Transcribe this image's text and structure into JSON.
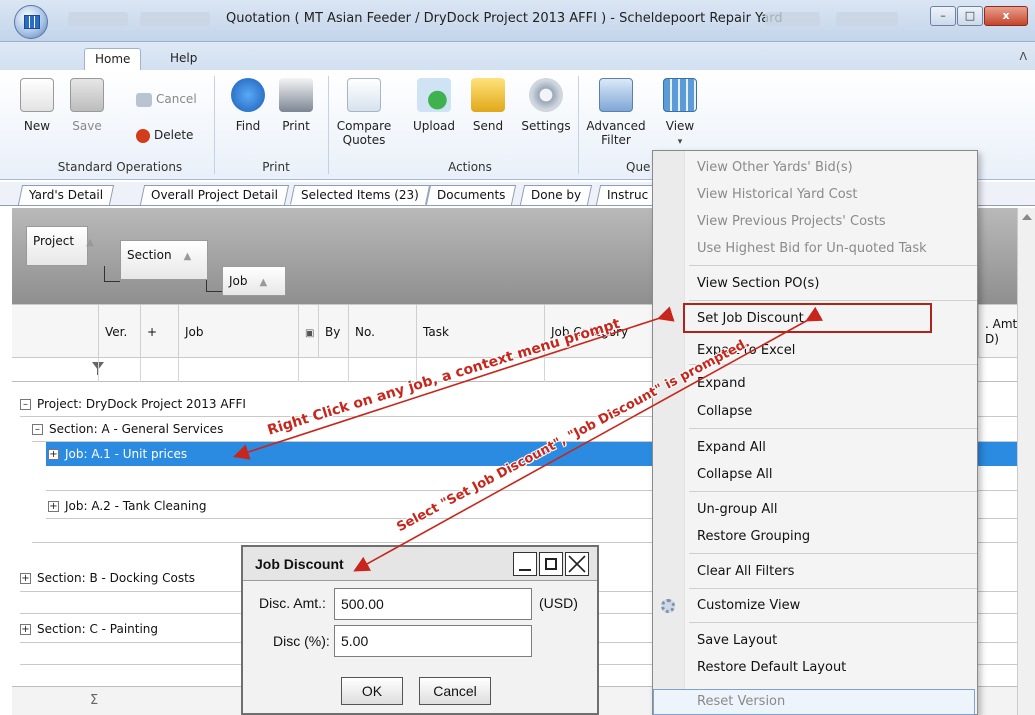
{
  "window": {
    "title": "Quotation ( MT Asian Feeder / DryDock Project 2013 AFFI ) - Scheldepoort Repair Yard",
    "controls": {
      "minimize": "–",
      "maximize": "□",
      "close": "x"
    }
  },
  "ribbon_tabs": [
    "Home",
    "Help"
  ],
  "ribbon": {
    "standard_operations": {
      "label": "Standard Operations",
      "new": "New",
      "save": "Save",
      "cancel": "Cancel",
      "delete": "Delete"
    },
    "print": {
      "label": "Print",
      "find": "Find",
      "print": "Print"
    },
    "actions": {
      "label": "Actions",
      "compare_quotes": "Compare Quotes",
      "upload": "Upload",
      "send": "Send",
      "settings": "Settings"
    },
    "query": {
      "label": "Que",
      "advanced_filter": "Advanced Filter",
      "view": "View"
    }
  },
  "doc_tabs": [
    "Yard's Detail",
    "Overall Project Detail",
    "Selected Items (23)",
    "Documents",
    "Done by",
    "Instruc"
  ],
  "group_by": [
    "Project",
    "Section",
    "Job"
  ],
  "grid": {
    "columns": [
      "Ver.",
      "+",
      "Job",
      "By",
      "No.",
      "Task",
      "Job Category"
    ],
    "right_column": ". Amt D)",
    "rows": [
      {
        "expander": "–",
        "text": "Project:  DryDock Project 2013 AFFI"
      },
      {
        "expander": "–",
        "text": "Section:  A - General Services"
      },
      {
        "expander": "+",
        "text": "Job:  A.1 - Unit prices"
      },
      {
        "expander": "+",
        "text": "Job:  A.2 - Tank Cleaning"
      },
      {
        "expander": "+",
        "text": "Section:  B - Docking Costs"
      },
      {
        "expander": "+",
        "text": "Section:  C - Painting"
      }
    ],
    "summary_symbol": "Σ"
  },
  "context_menu": {
    "items": [
      "View Other Yards' Bid(s)",
      "View Historical Yard Cost",
      "View Previous Projects' Costs",
      "Use Highest Bid for Un-quoted Task",
      "View Section PO(s)",
      "Set Job Discount",
      "Export to Excel",
      "Expand",
      "Collapse",
      "Expand All",
      "Collapse All",
      "Un-group All",
      "Restore Grouping",
      "Clear All Filters",
      "Customize View",
      "Save Layout",
      "Restore Default Layout",
      "Reset Version"
    ]
  },
  "dialog": {
    "title": "Job Discount",
    "disc_amt_label": "Disc. Amt.:",
    "disc_amt_value": "500.00",
    "currency": "(USD)",
    "disc_pct_label": "Disc (%):",
    "disc_pct_value": "5.00",
    "ok": "OK",
    "cancel": "Cancel"
  },
  "annotations": {
    "right_click": "Right Click on any job, a context menu prompt",
    "select": "Select \"Set Job Discount\", \"Job Discount\" is prompted."
  },
  "colors": {
    "selection": "#2a8be0",
    "annotation": "#c8261c",
    "highlight_box": "#b0221c"
  }
}
